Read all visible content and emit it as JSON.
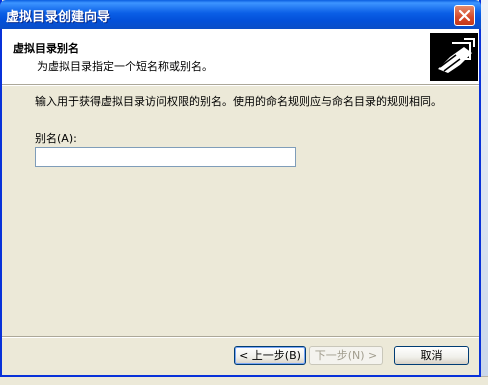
{
  "window": {
    "title": "虚拟目录创建向导"
  },
  "header": {
    "title": "虚拟目录别名",
    "subtitle": "为虚拟目录指定一个短名称或别名。"
  },
  "body": {
    "description": "输入用于获得虚拟目录访问权限的别名。使用的命名规则应与命名目录的规则相同。",
    "alias_label": "别名(A):",
    "alias_value": ""
  },
  "buttons": {
    "back": "< 上一步(B)",
    "next": "下一步(N) >",
    "cancel": "取消"
  },
  "icons": {
    "close": "close-icon",
    "wizard": "wizard-hand-document-icon"
  }
}
